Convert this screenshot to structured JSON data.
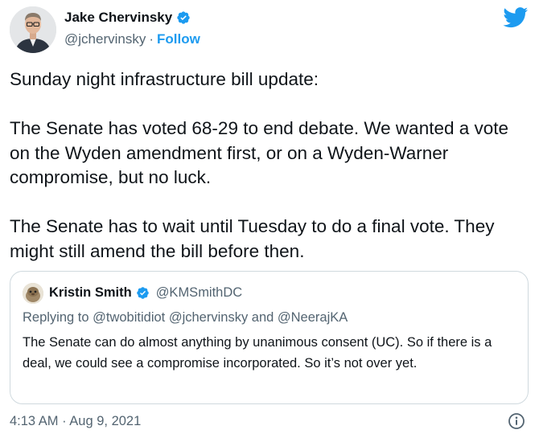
{
  "author": {
    "name": "Jake Chervinsky",
    "handle": "@jchervinsky",
    "separator": "·",
    "follow_label": "Follow",
    "verified": true
  },
  "icons": {
    "brand": "twitter-bird-icon",
    "verified": "verified-badge-icon",
    "info": "info-icon"
  },
  "colors": {
    "accent": "#1d9bf0",
    "text": "#0f1419",
    "secondary": "#536471",
    "border": "#cfd9de"
  },
  "tweet": {
    "paragraphs": [
      "Sunday night infrastructure bill update:",
      "The Senate has voted 68-29 to end debate. We wanted a vote on the Wyden amendment first, or on a Wyden-Warner compromise, but no luck.",
      "The Senate has to wait until Tuesday to do a final vote. They might still amend the bill before then."
    ],
    "timestamp": "4:13 AM · Aug 9, 2021"
  },
  "quoted": {
    "name": "Kristin Smith",
    "handle": "@KMSmithDC",
    "verified": true,
    "replying_to": "Replying to @twobitidiot @jchervinsky and @NeerajKA",
    "text": "The Senate can do almost anything by unanimous consent (UC). So if there is a deal, we could see a compromise incorporated. So it’s not over yet."
  }
}
